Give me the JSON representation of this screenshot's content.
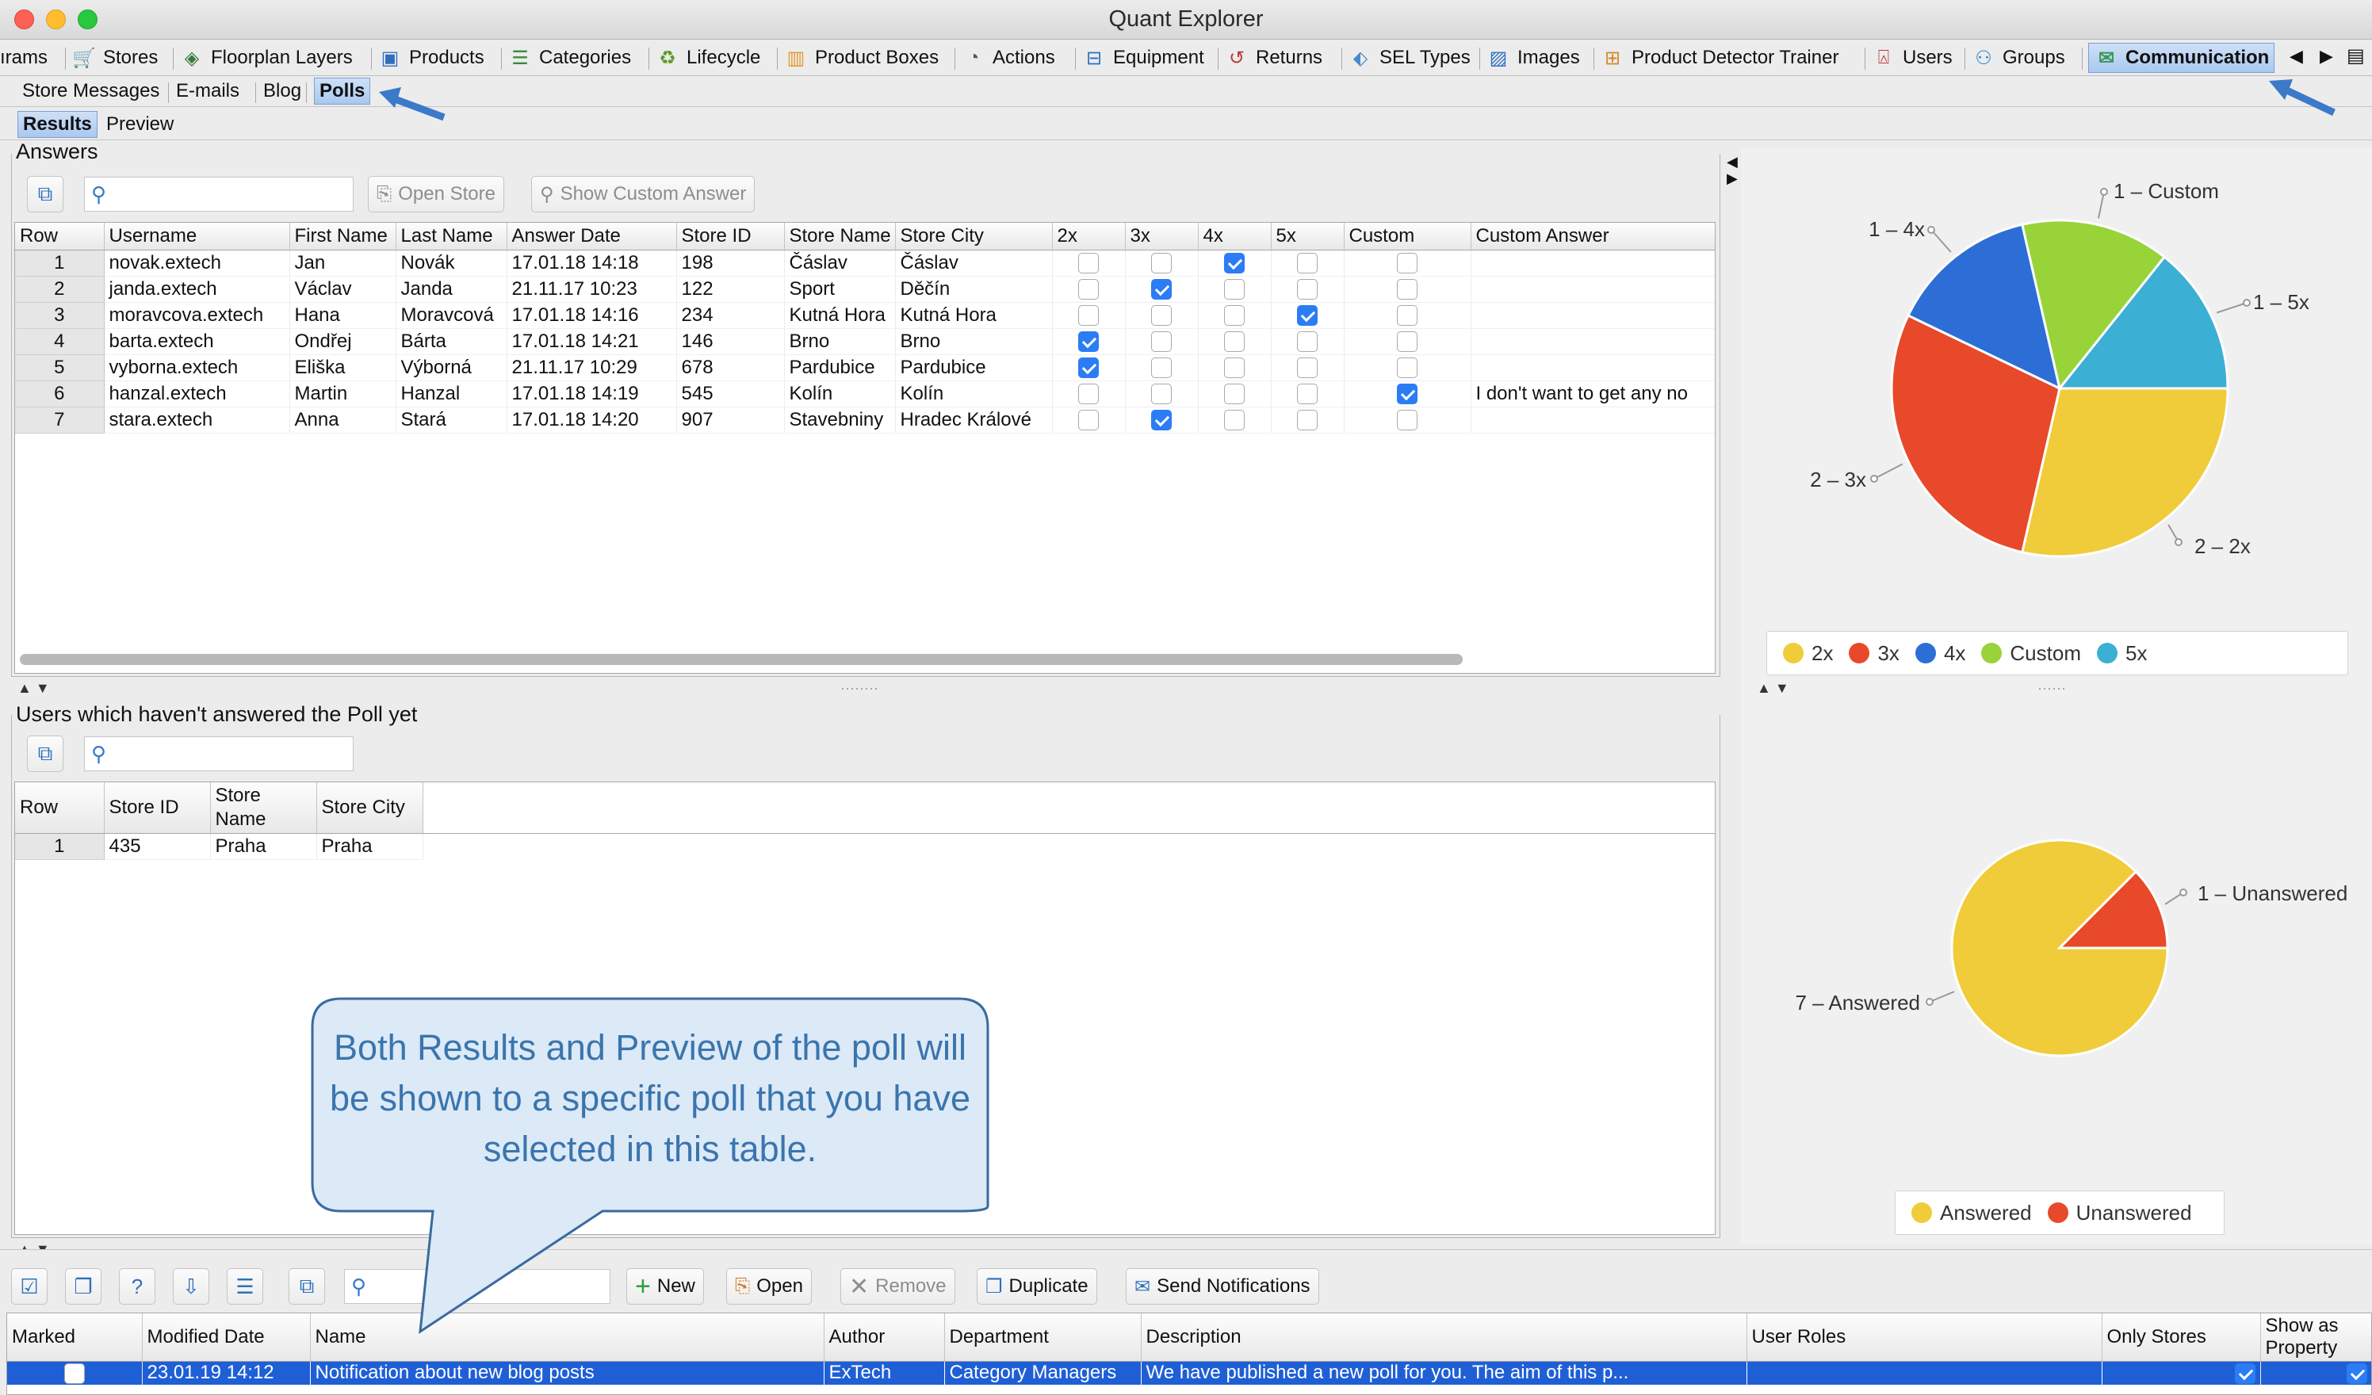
{
  "window": {
    "title": "Quant Explorer"
  },
  "tabs": [
    {
      "label": "ırams",
      "icon": "none",
      "x": 0
    },
    {
      "label": "Stores",
      "icon": "cart-icon",
      "x": 90
    },
    {
      "label": "Floorplan Layers",
      "icon": "layers-icon",
      "x": 226
    },
    {
      "label": "Products",
      "icon": "product-icon",
      "x": 476
    },
    {
      "label": "Categories",
      "icon": "list-icon",
      "x": 640
    },
    {
      "label": "Lifecycle",
      "icon": "lifecycle-icon",
      "x": 826
    },
    {
      "label": "Product Boxes",
      "icon": "boxes-icon",
      "x": 988
    },
    {
      "label": "Actions",
      "icon": "actions-icon",
      "x": 1212
    },
    {
      "label": "Equipment",
      "icon": "equipment-icon",
      "x": 1364
    },
    {
      "label": "Returns",
      "icon": "returns-icon",
      "x": 1544
    },
    {
      "label": "SEL Types",
      "icon": "tag-icon",
      "x": 1700
    },
    {
      "label": "Images",
      "icon": "image-icon",
      "x": 1874
    },
    {
      "label": "Product Detector Trainer",
      "icon": "trainer-icon",
      "x": 2018
    },
    {
      "label": "Users",
      "icon": "user-icon",
      "x": 2360
    },
    {
      "label": "Groups",
      "icon": "groups-icon",
      "x": 2486
    },
    {
      "label": "Communication",
      "icon": "mail-icon",
      "x": 2634,
      "active": true
    }
  ],
  "comm_subtabs": [
    {
      "label": "Store Messages"
    },
    {
      "label": "E-mails"
    },
    {
      "label": "Blog"
    },
    {
      "label": "Polls",
      "active": true
    }
  ],
  "view_subtabs": [
    {
      "label": "Results",
      "active": true
    },
    {
      "label": "Preview"
    }
  ],
  "answers": {
    "title": "Answers",
    "open_store_label": "Open Store",
    "show_custom_label": "Show Custom Answer",
    "search_placeholder": "",
    "columns": [
      "Row",
      "Username",
      "First Name",
      "Last Name",
      "Answer Date",
      "Store ID",
      "Store Name",
      "Store City",
      "2x",
      "3x",
      "4x",
      "5x",
      "Custom",
      "Custom Answer"
    ],
    "rows": [
      {
        "row": "1",
        "username": "novak.extech",
        "first": "Jan",
        "last": "Novák",
        "date": "17.01.18 14:18",
        "store_id": "198",
        "store_name": "Čáslav",
        "city": "Čáslav",
        "c2x": false,
        "c3x": false,
        "c4x": true,
        "c5x": false,
        "custom": false,
        "custom_answer": ""
      },
      {
        "row": "2",
        "username": "janda.extech",
        "first": "Václav",
        "last": "Janda",
        "date": "21.11.17 10:23",
        "store_id": "122",
        "store_name": "Sport",
        "city": "Děčín",
        "c2x": false,
        "c3x": true,
        "c4x": false,
        "c5x": false,
        "custom": false,
        "custom_answer": ""
      },
      {
        "row": "3",
        "username": "moravcova.extech",
        "first": "Hana",
        "last": "Moravcová",
        "date": "17.01.18 14:16",
        "store_id": "234",
        "store_name": "Kutná Hora",
        "city": "Kutná Hora",
        "c2x": false,
        "c3x": false,
        "c4x": false,
        "c5x": true,
        "custom": false,
        "custom_answer": ""
      },
      {
        "row": "4",
        "username": "barta.extech",
        "first": "Ondřej",
        "last": "Bárta",
        "date": "17.01.18 14:21",
        "store_id": "146",
        "store_name": "Brno",
        "city": "Brno",
        "c2x": true,
        "c3x": false,
        "c4x": false,
        "c5x": false,
        "custom": false,
        "custom_answer": ""
      },
      {
        "row": "5",
        "username": "vyborna.extech",
        "first": "Eliška",
        "last": "Výborná",
        "date": "21.11.17 10:29",
        "store_id": "678",
        "store_name": "Pardubice",
        "city": "Pardubice",
        "c2x": true,
        "c3x": false,
        "c4x": false,
        "c5x": false,
        "custom": false,
        "custom_answer": ""
      },
      {
        "row": "6",
        "username": "hanzal.extech",
        "first": "Martin",
        "last": "Hanzal",
        "date": "17.01.18 14:19",
        "store_id": "545",
        "store_name": "Kolín",
        "city": "Kolín",
        "c2x": false,
        "c3x": false,
        "c4x": false,
        "c5x": false,
        "custom": true,
        "custom_answer": "I don't want to get any no"
      },
      {
        "row": "7",
        "username": "stara.extech",
        "first": "Anna",
        "last": "Stará",
        "date": "17.01.18 14:20",
        "store_id": "907",
        "store_name": "Stavebniny",
        "city": "Hradec Králové",
        "c2x": false,
        "c3x": true,
        "c4x": false,
        "c5x": false,
        "custom": false,
        "custom_answer": ""
      }
    ]
  },
  "unanswered": {
    "title": "Users which haven't answered the Poll yet",
    "columns": [
      "Row",
      "Store ID",
      "Store Name",
      "Store City"
    ],
    "rows": [
      {
        "row": "1",
        "store_id": "435",
        "store_name": "Praha",
        "city": "Praha"
      }
    ]
  },
  "callout": {
    "text": "Both Results and Preview of the poll will be shown to a specific poll that you have selected in this table."
  },
  "polls_toolbar": {
    "new_label": "New",
    "open_label": "Open",
    "remove_label": "Remove",
    "duplicate_label": "Duplicate",
    "send_label": "Send Notifications"
  },
  "polls_table": {
    "columns": [
      "Marked",
      "Modified Date",
      "Name",
      "Author",
      "Department",
      "Description",
      "User Roles",
      "Only Stores",
      "Show as Property"
    ],
    "rows": [
      {
        "marked": false,
        "modified": "23.01.19 14:12",
        "name": "Notification about new blog posts",
        "author": "ExTech",
        "department": "Category Managers",
        "description": "We have published a new poll for you. The aim of this p...",
        "roles": "",
        "only_stores": true,
        "show_prop": true
      }
    ]
  },
  "chart_data": [
    {
      "type": "pie",
      "series": [
        {
          "name": "2x",
          "value": 2,
          "color": "#f0cc3a",
          "label": "2 – 2x"
        },
        {
          "name": "3x",
          "value": 2,
          "color": "#e8492a",
          "label": "2 – 3x"
        },
        {
          "name": "4x",
          "value": 1,
          "color": "#2c6ed6",
          "label": "1 – 4x"
        },
        {
          "name": "Custom",
          "value": 1,
          "color": "#98d33a",
          "label": "1 – Custom"
        },
        {
          "name": "5x",
          "value": 1,
          "color": "#3cafd4",
          "label": "1 – 5x"
        }
      ],
      "legend": [
        "2x",
        "3x",
        "4x",
        "Custom",
        "5x"
      ]
    },
    {
      "type": "pie",
      "series": [
        {
          "name": "Answered",
          "value": 7,
          "color": "#f0cc3a",
          "label": "7 – Answered"
        },
        {
          "name": "Unanswered",
          "value": 1,
          "color": "#e8492a",
          "label": "1 – Unanswered"
        }
      ],
      "legend": [
        "Answered",
        "Unanswered"
      ]
    }
  ]
}
